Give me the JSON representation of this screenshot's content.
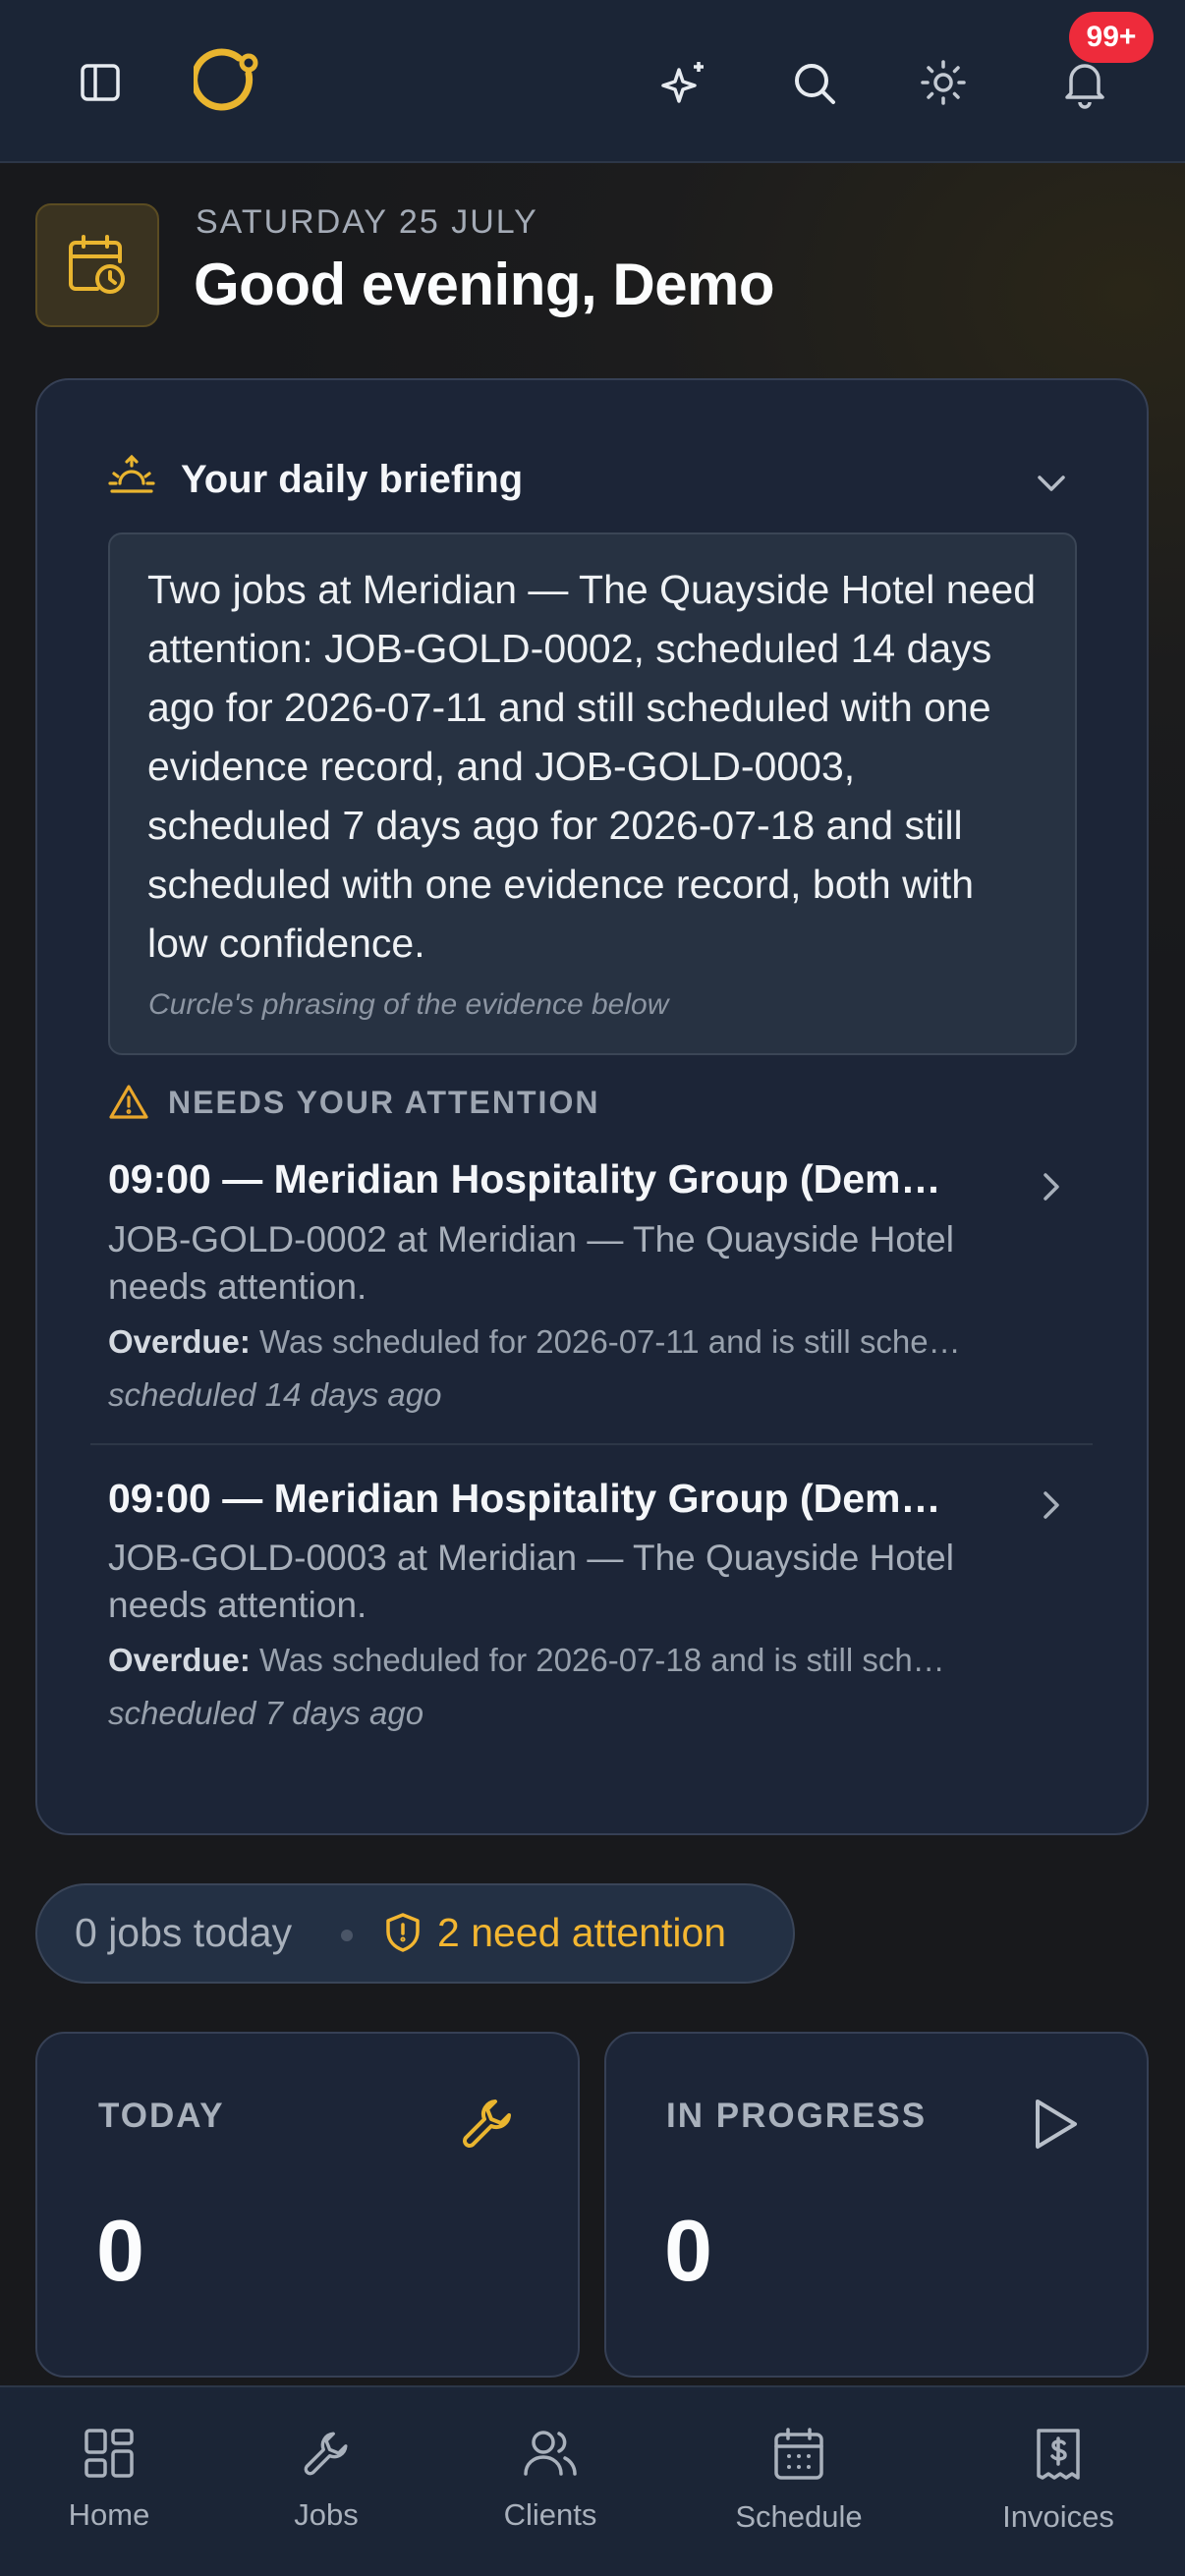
{
  "header": {
    "icons": [
      "sidebar-toggle-icon",
      "logo-icon",
      "sparkles-icon",
      "search-icon",
      "sun-icon",
      "bell-icon"
    ],
    "notification_count": "99+"
  },
  "greeting": {
    "date": "SATURDAY 25 JULY",
    "text": "Good evening, Demo"
  },
  "briefing": {
    "title": "Your daily briefing",
    "summary": "Two jobs at Meridian — The Quayside Hotel need attention: JOB-GOLD-0002, scheduled 14 days ago for 2026-07-11 and still scheduled with one evidence record, and JOB-GOLD-0003, scheduled 7 days ago for 2026-07-18 and still scheduled with one evidence record, both with low confidence.",
    "note": "Curcle's phrasing of the evidence below",
    "attention_label": "NEEDS YOUR ATTENTION",
    "items": [
      {
        "title": "09:00 — Meridian Hospitality Group (Dem…",
        "description": "JOB-GOLD-0002 at Meridian — The Quayside Hotel needs attention.",
        "overdue_label": "Overdue:",
        "overdue_text": "Was scheduled for 2026-07-11 and is still sche…",
        "when": "scheduled 14 days ago"
      },
      {
        "title": "09:00 — Meridian Hospitality Group (Dem…",
        "description": "JOB-GOLD-0003 at Meridian — The Quayside Hotel needs attention.",
        "overdue_label": "Overdue:",
        "overdue_text": "Was scheduled for 2026-07-18 and is still sch…",
        "when": "scheduled 7 days ago"
      }
    ]
  },
  "summary_pill": {
    "jobs_today": "0 jobs today",
    "need_attention": "2 need attention"
  },
  "stats": [
    {
      "label": "TODAY",
      "value": "0",
      "icon": "wrench-icon"
    },
    {
      "label": "IN PROGRESS",
      "value": "0",
      "icon": "play-icon"
    }
  ],
  "nav": [
    {
      "label": "Home",
      "icon": "grid-icon"
    },
    {
      "label": "Jobs",
      "icon": "wrench-icon"
    },
    {
      "label": "Clients",
      "icon": "users-icon"
    },
    {
      "label": "Schedule",
      "icon": "calendar-icon"
    },
    {
      "label": "Invoices",
      "icon": "receipt-icon"
    }
  ],
  "colors": {
    "accent": "#f3b631",
    "badge": "#ee2b3b",
    "surface": "#1c2537",
    "bar": "#1b2536"
  }
}
